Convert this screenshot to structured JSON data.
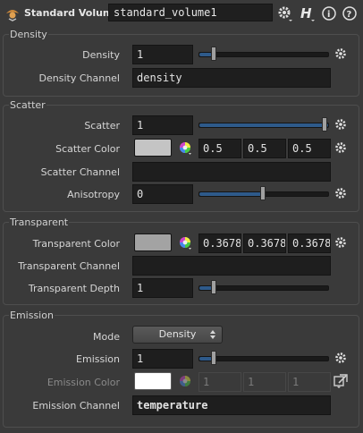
{
  "header": {
    "node_type": "Standard Volume",
    "node_name": "standard_volume1",
    "help_glyph": "H",
    "info_glyph": "i",
    "question_glyph": "?"
  },
  "density": {
    "title": "Density",
    "density_label": "Density",
    "density_value": "1",
    "density_slider": 0.1,
    "channel_label": "Density Channel",
    "channel_value": "density"
  },
  "scatter": {
    "title": "Scatter",
    "scatter_label": "Scatter",
    "scatter_value": "1",
    "scatter_slider": 1.0,
    "color_label": "Scatter Color",
    "color_swatch": "#c4c4c4",
    "color_r": "0.5",
    "color_g": "0.5",
    "color_b": "0.5",
    "channel_label": "Scatter Channel",
    "channel_value": "",
    "aniso_label": "Anisotropy",
    "aniso_value": "0",
    "aniso_slider": 0.5
  },
  "transparent": {
    "title": "Transparent",
    "color_label": "Transparent Color",
    "color_swatch": "#a3a3a3",
    "color_r": "0.3678",
    "color_g": "0.3678",
    "color_b": "0.3678",
    "channel_label": "Transparent Channel",
    "channel_value": "",
    "depth_label": "Transparent Depth",
    "depth_value": "1",
    "depth_slider": 0.1
  },
  "emission": {
    "title": "Emission",
    "mode_label": "Mode",
    "mode_value": "Density",
    "emission_label": "Emission",
    "emission_value": "1",
    "emission_slider": 0.1,
    "color_label": "Emission Color",
    "color_swatch": "#ffffff",
    "color_r": "1",
    "color_g": "1",
    "color_b": "1",
    "channel_label": "Emission Channel",
    "channel_value": "temperature"
  },
  "colors": {
    "background": "#3a3a3a",
    "field": "#1e1e1e",
    "slider_fill": "#2e5a8a",
    "accent_blue": "#4a8fd6"
  },
  "icons": [
    "node-type-icon",
    "gear-icon",
    "help-icon",
    "info-icon",
    "question-icon",
    "color-wheel-icon",
    "dropdown-arrow-icon",
    "link-icon"
  ]
}
